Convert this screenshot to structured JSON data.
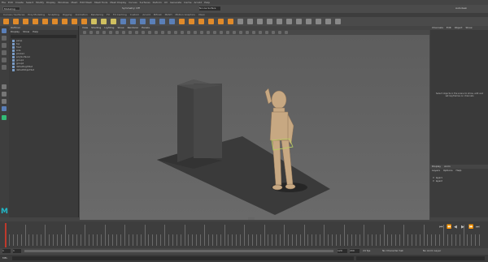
{
  "app": {
    "title": "Maya"
  },
  "menubar": {
    "items": [
      "File",
      "Edit",
      "Create",
      "Select",
      "Modify",
      "Display",
      "Windows",
      "Mesh",
      "Edit Mesh",
      "Mesh Tools",
      "Mesh Display",
      "Curves",
      "Surfaces",
      "Deform",
      "UV",
      "Generate",
      "Cache",
      "Arnold",
      "Help"
    ]
  },
  "status": {
    "mode": "Modeling",
    "workspace": "Maya Classic",
    "symmetry": "Symmetry: Off",
    "live": "No Live Surface",
    "sign_in": "Autodesk"
  },
  "shelf_tabs": [
    "Curves / Surfaces",
    "Poly Modeling",
    "Sculpting",
    "Rigging",
    "Animation",
    "Rendering",
    "FX",
    "FX Caching",
    "Custom",
    "Arnold",
    "Bifrost",
    "MASH",
    "Motion Graphics",
    "XGen"
  ],
  "outliner": {
    "title": "Outliner",
    "menu": [
      "Display",
      "Show",
      "Help"
    ],
    "search_placeholder": "Search...",
    "items": [
      "persp",
      "top",
      "front",
      "side",
      "pCube1",
      "polySurface1",
      "group1",
      "group2",
      "defaultLightSet",
      "defaultObjectSet"
    ]
  },
  "viewport": {
    "menu": [
      "View",
      "Shading",
      "Lighting",
      "Show",
      "Renderer",
      "Panels"
    ],
    "camera_label": "persp"
  },
  "attribute_editor": {
    "tabs": [
      "Channels",
      "Edit",
      "Object",
      "Show"
    ],
    "message": "Select objects in the scene to show, edit and set keyframes on channels"
  },
  "layer_editor": {
    "tabs": [
      "Display",
      "Anim"
    ],
    "menu": [
      "Layers",
      "Options",
      "Help"
    ],
    "layers": [
      "layer1",
      "layer2"
    ]
  },
  "timeline": {
    "start": "1",
    "end": "120",
    "current": "1"
  },
  "range": {
    "start": "1",
    "end": "120",
    "anim_end": "200",
    "fps": "24 fps",
    "character": "No Character Set",
    "anim_layer": "No Anim Layer"
  },
  "command": {
    "lang": "MEL"
  },
  "colors": {
    "accent_orange": "#e08a2a",
    "maya_blue": "#5a7fb8",
    "maya_logo": "#21b8c8"
  }
}
